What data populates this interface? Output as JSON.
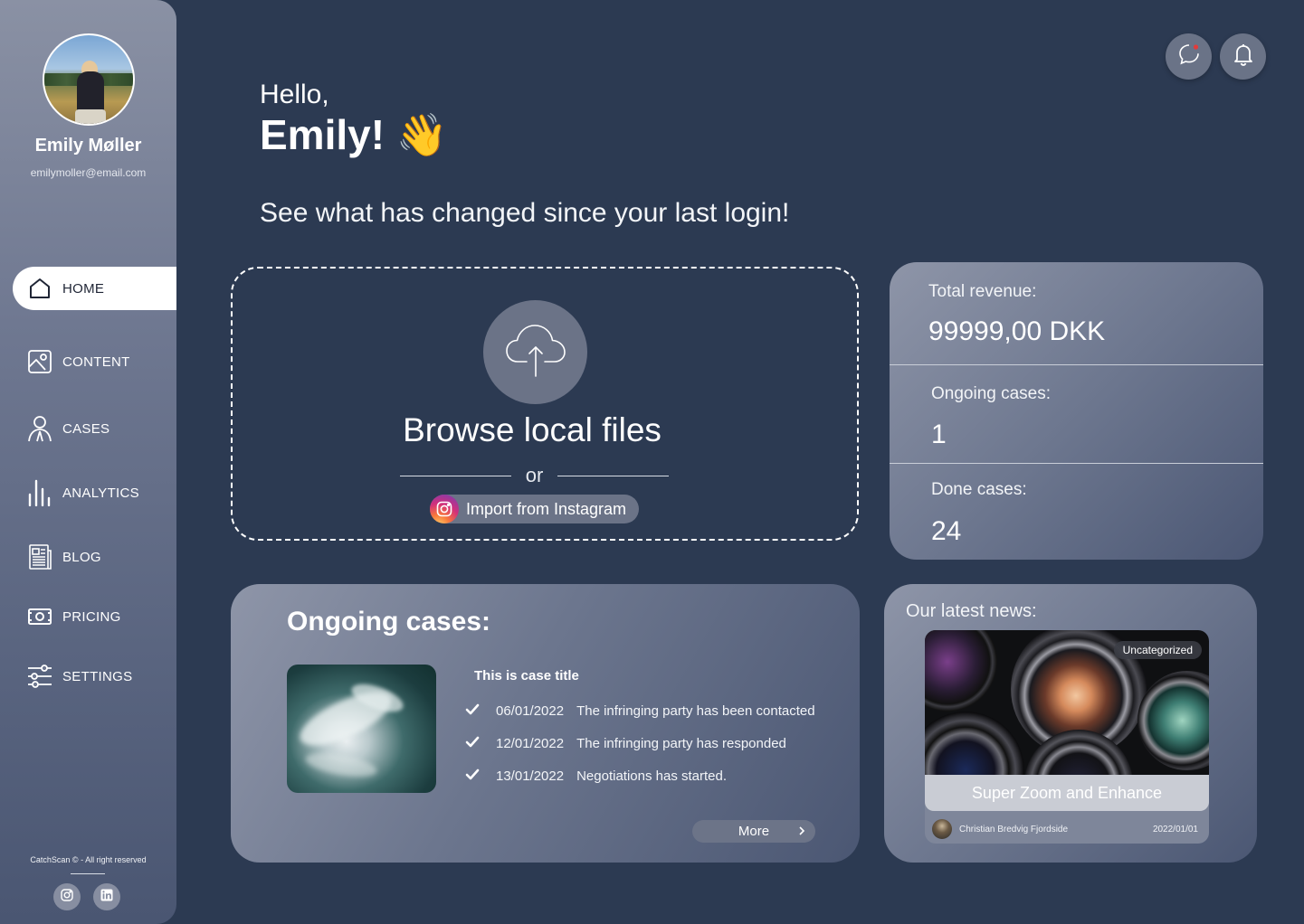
{
  "sidebar": {
    "user_name": "Emily Møller",
    "user_email": "emilymoller@email.com",
    "nav": [
      {
        "label": "HOME",
        "icon": "home-icon",
        "active": true
      },
      {
        "label": "CONTENT",
        "icon": "image-icon"
      },
      {
        "label": "CASES",
        "icon": "person-icon"
      },
      {
        "label": "ANALYTICS",
        "icon": "bar-chart-icon"
      },
      {
        "label": "BLOG",
        "icon": "newspaper-icon"
      },
      {
        "label": "PRICING",
        "icon": "cash-icon"
      },
      {
        "label": "SETTINGS",
        "icon": "sliders-icon"
      }
    ],
    "copyright": "CatchScan © - All right reserved",
    "social": [
      "instagram-icon",
      "linkedin-icon"
    ]
  },
  "header": {
    "greeting": "Hello,",
    "name": "Emily!",
    "wave_emoji": "👋",
    "tagline": "See what has changed since your last login!"
  },
  "upload": {
    "browse_label": "Browse local files",
    "or_label": "or",
    "instagram_label": "Import from Instagram"
  },
  "stats": {
    "revenue_label": "Total revenue:",
    "revenue_value": "99999,00 DKK",
    "ongoing_label": "Ongoing cases:",
    "ongoing_value": "1",
    "done_label": "Done cases:",
    "done_value": "24"
  },
  "cases": {
    "title": "Ongoing cases:",
    "case_title": "This is case title",
    "steps": [
      {
        "date": "06/01/2022",
        "text": "The infringing party has been contacted"
      },
      {
        "date": "12/01/2022",
        "text": "The infringing party has responded"
      },
      {
        "date": "13/01/2022",
        "text": "Negotiations has started."
      }
    ],
    "more_label": "More"
  },
  "news": {
    "heading": "Our latest news:",
    "badge": "Uncategorized",
    "title": "Super Zoom and Enhance",
    "author": "Christian Bredvig Fjordside",
    "date": "2022/01/01"
  },
  "colors": {
    "background": "#2c3a52",
    "panel": "#6c768e",
    "accent_white": "#ffffff"
  }
}
